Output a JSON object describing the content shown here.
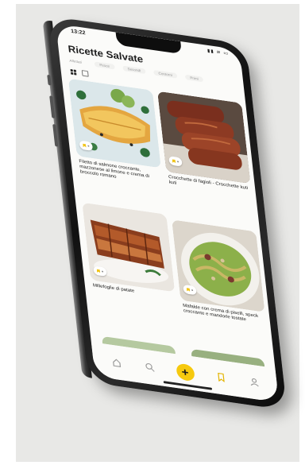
{
  "status": {
    "time": "13:22",
    "icons": "▮▮ ≋ ▭"
  },
  "header": {
    "title": "Ricette Salvate"
  },
  "tabs": [
    "Affettati",
    "Pesce",
    "Secondi",
    "Contorni",
    "Primi"
  ],
  "cards": [
    {
      "name": "Filetto di salmone croccante, mazzonese al limone e crema di broccolo romano",
      "mark_icon": "bookmark-icon"
    },
    {
      "name": "Crocchette di fagioli - Crocchette kuti kuti",
      "mark_icon": "bookmark-icon"
    },
    {
      "name": "Millefoglie di patate",
      "mark_icon": "bookmark-icon"
    },
    {
      "name": "Mafalde con crema di piselli, speck croccante e mandorle tostate",
      "mark_icon": "bookmark-icon"
    }
  ],
  "bottom_nav": {
    "items": [
      "home-icon",
      "search-icon",
      "add-icon",
      "bookmark-icon",
      "profile-icon"
    ],
    "add_label": "+"
  },
  "colors": {
    "accent": "#f6c90e",
    "screen": "#fbfbf9",
    "frame": "#141414"
  }
}
